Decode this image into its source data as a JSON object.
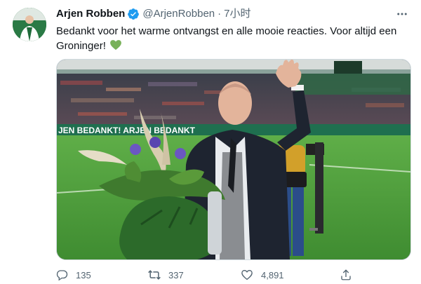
{
  "tweet": {
    "author_name": "Arjen Robben",
    "handle": "@ArjenRobben",
    "separator": "·",
    "time": "7小时",
    "text": "Bedankt voor het warme ontvangst en alle mooie reacties. Voor altijd een Groninger!",
    "emoji": "green-heart",
    "verified": true,
    "media": {
      "banner_text": "JEN BEDANKT!   ARJEN BEDANKT"
    },
    "actions": {
      "reply_count": "135",
      "retweet_count": "337",
      "like_count": "4,891"
    }
  },
  "colors": {
    "verified_blue": "#1d9bf0",
    "secondary_text": "#536471",
    "heart_green": "#78b159"
  }
}
